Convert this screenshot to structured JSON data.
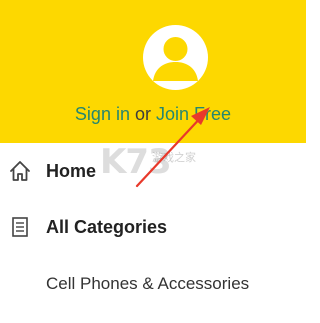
{
  "header": {
    "background_color": "#fdd800",
    "avatar_icon": "user-avatar-icon",
    "sign_in_label": "Sign in",
    "separator_label": "or",
    "join_label": "Join Free",
    "link_color": "#26876f"
  },
  "menu": {
    "items": [
      {
        "label": "Home",
        "icon": "home-icon"
      },
      {
        "label": "All Categories",
        "icon": "document-list-icon"
      }
    ],
    "sub_items": [
      {
        "label": "Cell Phones & Accessories"
      }
    ]
  },
  "watermark": {
    "logo_text": "K73",
    "tagline": "游戏之家",
    "arrow_color": "#e8392b"
  }
}
